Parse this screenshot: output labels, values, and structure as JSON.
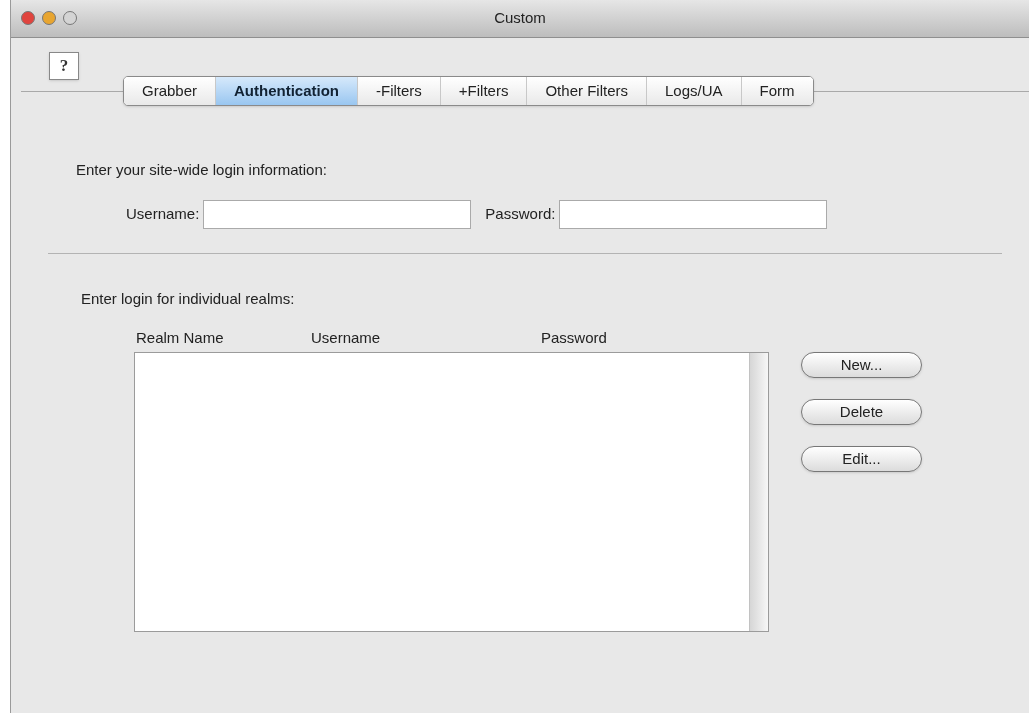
{
  "window": {
    "title": "Custom",
    "controls": [
      {
        "kind": "close",
        "active": true
      },
      {
        "kind": "minimize",
        "active": true
      },
      {
        "kind": "zoom",
        "active": false
      }
    ]
  },
  "help_button": {
    "label": "?"
  },
  "tabs": [
    {
      "label": "Grabber",
      "selected": false
    },
    {
      "label": "Authentication",
      "selected": true
    },
    {
      "label": "-Filters",
      "selected": false
    },
    {
      "label": "+Filters",
      "selected": false
    },
    {
      "label": "Other Filters",
      "selected": false
    },
    {
      "label": "Logs/UA",
      "selected": false
    },
    {
      "label": "Form",
      "selected": false
    }
  ],
  "site_login": {
    "heading": "Enter your site-wide login information:",
    "fields": [
      {
        "label": "Username:"
      },
      {
        "label": "Password:"
      }
    ]
  },
  "realms": {
    "heading": "Enter login for individual realms:",
    "columns": [
      "Realm Name",
      "Username",
      "Password"
    ]
  },
  "buttons": [
    "New...",
    "Delete",
    "Edit..."
  ]
}
